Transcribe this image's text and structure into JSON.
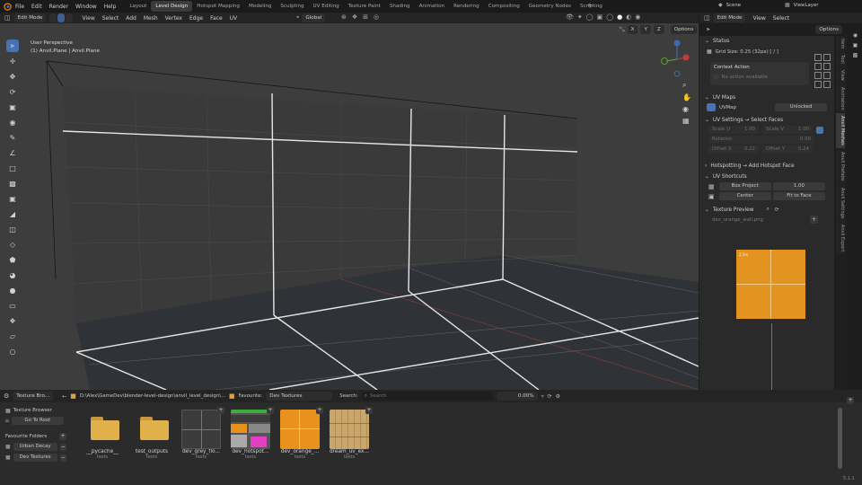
{
  "menu": [
    "File",
    "Edit",
    "Render",
    "Window",
    "Help"
  ],
  "workspaces": [
    "Layout",
    "Level Design",
    "Hotspot Mapping",
    "Modeling",
    "Sculpting",
    "UV Editing",
    "Texture Paint",
    "Shading",
    "Animation",
    "Rendering",
    "Compositing",
    "Geometry Nodes",
    "Scripting"
  ],
  "active_workspace": "Level Design",
  "scene": "Scene",
  "view_layer": "ViewLayer",
  "viewport_header": {
    "mode": "Edit Mode",
    "menus": [
      "View",
      "Select",
      "Add",
      "Mesh",
      "Vertex",
      "Edge",
      "Face",
      "UV"
    ],
    "orientation": "Global",
    "axes": [
      "X",
      "Y",
      "Z"
    ],
    "options": "Options"
  },
  "overlay": {
    "view": "User Perspective",
    "object": "(1) Anvil.Plane | Anvil.Plane"
  },
  "npanel_header": {
    "mode": "Edit Mode",
    "menus": [
      "View",
      "Select"
    ],
    "options": "Options"
  },
  "npanel": {
    "status_title": "Status",
    "grid_size": "Grid Size: 0.25  (32px)  [ / ]",
    "context_title": "Context Action",
    "context_value": "No action available",
    "uv_maps_title": "UV Maps",
    "uv_map": "UVMap",
    "unlocked": "Unlocked",
    "uv_settings_title": "UV Settings  →  Select Faces",
    "scale_u_label": "Scale U",
    "scale_u": "1.00",
    "scale_v_label": "Scale V",
    "scale_v": "1.00",
    "rotation_label": "Rotation",
    "rotation": "0.00",
    "offset_x_label": "Offset X",
    "offset_x": "0.22",
    "offset_y_label": "Offset Y",
    "offset_y": "0.24",
    "hotspot_title": "Hotspotting  →  Add Hotspot Face",
    "uv_shortcuts_title": "UV Shortcuts",
    "box_project": "Box Project",
    "box_value": "1.00",
    "center": "Center",
    "fit": "Fit to Face",
    "preview_title": "Texture Preview",
    "preview_file": "dev_orange_wall.png",
    "preview_tag": "2,5m"
  },
  "ntabs": [
    "Item",
    "Tool",
    "View",
    "Animation",
    "Anvil Meshes",
    "Anvil Prefabs",
    "Anvil Settings",
    "Anvil Export"
  ],
  "active_ntab": "Anvil Meshes",
  "browser": {
    "editor": "Texture Bro...",
    "path": "D:\\Alex\\GameDev\\blender-level-design\\anvil_level_design\\...",
    "favourite_label": "Favourite:",
    "favourite_value": "Dev Textures",
    "search_label": "Search:",
    "search_placeholder": "Search",
    "percent": "0.00%",
    "sidebar_title": "Texture Browser",
    "go_home": "Go To Root",
    "fav_title": "Favourite Folders",
    "folders": [
      "Urban Decay",
      "Dev Textures"
    ],
    "version": "5.1.1",
    "tiles": [
      {
        "name": "__pycache__",
        "sub": "tests"
      },
      {
        "name": "test_outputs",
        "sub": "tests"
      },
      {
        "name": "dev_grey_flo...",
        "sub": "tests"
      },
      {
        "name": "dev_hotspot...",
        "sub": "tests"
      },
      {
        "name": "dev_orange_...",
        "sub": "tests"
      },
      {
        "name": "dream_uv_ex...",
        "sub": "tests"
      }
    ]
  },
  "colors": {
    "accent": "#4772b3",
    "orange": "#e8911c",
    "folder": "#e0b04a"
  }
}
